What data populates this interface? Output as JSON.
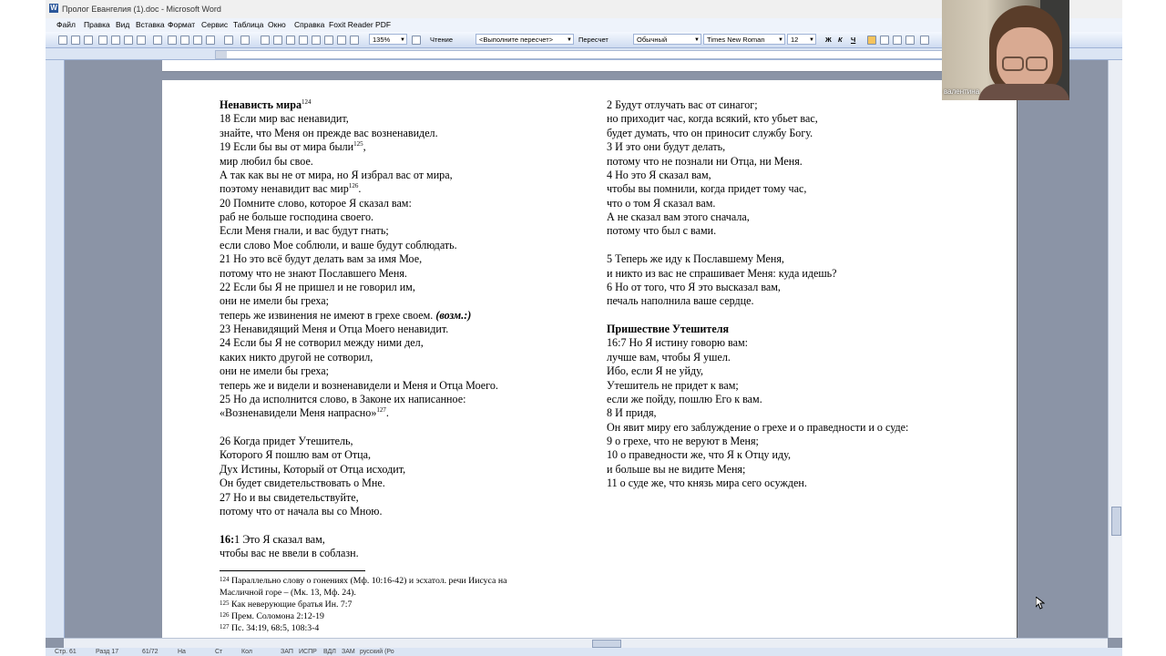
{
  "window": {
    "title": "Пролог Евангелия (1).doc - Microsoft Word"
  },
  "menu": [
    "Файл",
    "Правка",
    "Вид",
    "Вставка",
    "Формат",
    "Сервис",
    "Таблица",
    "Окно",
    "Справка",
    "Foxit Reader PDF"
  ],
  "toolbar": {
    "zoom": "135%",
    "reading_label": "Чтение",
    "recount_combo": "<Выполните пересчет>",
    "recount_button": "Пересчет",
    "style": "Обычный",
    "font": "Times New Roman",
    "size": "12",
    "bold": "Ж",
    "italic": "К",
    "underline": "Ч"
  },
  "left_column": [
    {
      "t": "Ненависть мира",
      "sup": "124",
      "bold": true
    },
    {
      "t": "18 Если мир вас ненавидит,"
    },
    {
      "t": "знайте, что Меня он прежде вас возненавидел."
    },
    {
      "t": "19 Если бы вы от мира были",
      "sup": "125",
      "after": ","
    },
    {
      "t": "мир любил бы свое."
    },
    {
      "t": "А так как вы не от мира, но Я избрал вас от мира,"
    },
    {
      "t": "поэтому ненавидит вас мир",
      "sup": "126",
      "after": "."
    },
    {
      "t": "20 Помните слово, которое Я сказал вам:"
    },
    {
      "t": "раб не больше господина своего."
    },
    {
      "t": "Если Меня гнали, и вас будут гнать;"
    },
    {
      "t": "если слово Мое соблюли, и ваше будут соблюдать."
    },
    {
      "t": "21 Но это всё будут делать вам за имя Мое,"
    },
    {
      "t": "потому что не знают Пославшего Меня."
    },
    {
      "t": "22 Если бы Я не пришел и не говорил им,"
    },
    {
      "t": "они не имели бы греха;"
    },
    {
      "t": "теперь же извинения не имеют в грехе своем.",
      "italic_after": "(возм.:)"
    },
    {
      "t": "23 Ненавидящий Меня и Отца Моего ненавидит."
    },
    {
      "t": "24 Если бы Я не сотворил между ними дел,"
    },
    {
      "t": "каких никто другой не сотворил,"
    },
    {
      "t": "они не имели бы греха;"
    },
    {
      "t": "теперь же и видели и возненавидели и Меня и Отца Моего."
    },
    {
      "t": "25 Но да исполнится слово, в Законе их написанное:"
    },
    {
      "t": "«Возненавидели Меня напрасно»",
      "sup": "127",
      "after": "."
    },
    {
      "t": ""
    },
    {
      "t": "26 Когда придет Утешитель,"
    },
    {
      "t": "Которого Я пошлю вам от Отца,"
    },
    {
      "t": "Дух Истины, Который от Отца исходит,"
    },
    {
      "t": "Он будет свидетельствовать о Мне."
    },
    {
      "t": "27 Но и вы свидетельствуйте,"
    },
    {
      "t": "потому что от начала вы со Мною."
    },
    {
      "t": ""
    },
    {
      "t": "1 Это Я сказал вам,",
      "bold_prefix": "16:"
    },
    {
      "t": "чтобы вас не ввели в соблазн."
    }
  ],
  "right_column": [
    {
      "t": "2 Будут отлучать вас от синагог;"
    },
    {
      "t": "но приходит час, когда всякий, кто убьет вас,"
    },
    {
      "t": "будет думать, что он приносит службу Богу."
    },
    {
      "t": "3 И это они будут делать,"
    },
    {
      "t": "потому что не познали ни Отца, ни Меня."
    },
    {
      "t": "4 Но это Я сказал вам,"
    },
    {
      "t": "чтобы вы помнили, когда придет тому час,"
    },
    {
      "t": "что о том Я сказал вам."
    },
    {
      "t": "А не сказал вам этого сначала,"
    },
    {
      "t": "потому что был с вами."
    },
    {
      "t": ""
    },
    {
      "t": "5 Теперь же иду к Пославшему Меня,"
    },
    {
      "t": "и никто из вас не спрашивает Меня: куда идешь?"
    },
    {
      "t": "6 Но от того, что Я это высказал вам,"
    },
    {
      "t": "печаль наполнила ваше сердце."
    },
    {
      "t": ""
    },
    {
      "t": "Пришествие Утешителя",
      "bold": true
    },
    {
      "t": "16:7 Но Я истину говорю вам:"
    },
    {
      "t": "лучше вам, чтобы Я ушел."
    },
    {
      "t": "Ибо, если Я не уйду,"
    },
    {
      "t": "Утешитель не придет к вам;"
    },
    {
      "t": "если же пойду, пошлю Его к вам."
    },
    {
      "t": "8 И придя,"
    },
    {
      "t": "Он явит миру его заблуждение о грехе и о праведности и о суде:"
    },
    {
      "t": "9 о грехе, что не веруют в Меня;"
    },
    {
      "t": "10 о праведности же, что Я к Отцу иду,"
    },
    {
      "t": "и больше вы не видите Меня;"
    },
    {
      "t": "11 о суде же, что князь мира сего осужден."
    }
  ],
  "footnotes": [
    {
      "n": "124",
      "t": "Параллельно слову о гонениях (Мф. 10:16-42) и эсхатол. речи Иисуса на"
    },
    {
      "n": "",
      "t": "Масличной горе – (Мк. 13, Мф. 24)."
    },
    {
      "n": "125",
      "t": "Как неверующие братья Ин. 7:7"
    },
    {
      "n": "126",
      "t": "Прем. Соломона 2:12-19"
    },
    {
      "n": "127",
      "t": "Пс. 34:19, 68:5, 108:3-4"
    }
  ],
  "status": {
    "page": "Стр. 61",
    "section": "Разд 17",
    "pages": "61/72",
    "at": "На",
    "line": "Ст",
    "col": "Кол",
    "rec": "ЗАП",
    "trk": "ИСПР",
    "ext": "ВДЛ",
    "ovr": "ЗАМ",
    "lang": "русский (Ро"
  },
  "video": {
    "participant_name": "валентина"
  },
  "colors": {
    "desktop_bg": "#8b94a6",
    "toolbar_bg": "#dbe5f4"
  }
}
